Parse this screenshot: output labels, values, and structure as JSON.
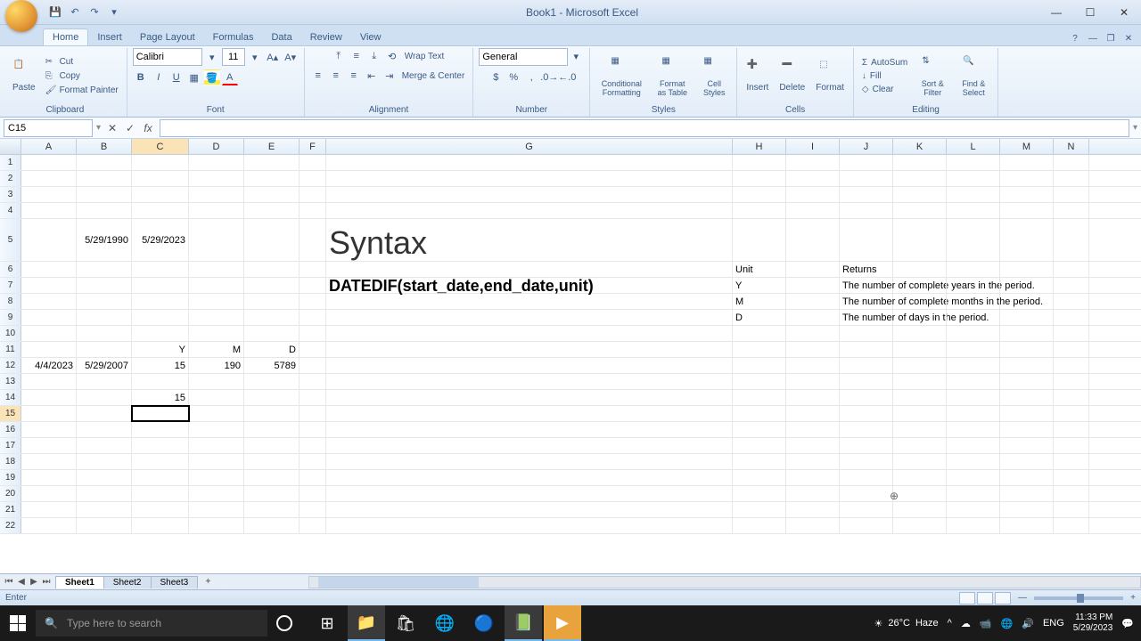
{
  "title": "Book1 - Microsoft Excel",
  "tabs": [
    "Home",
    "Insert",
    "Page Layout",
    "Formulas",
    "Data",
    "Review",
    "View"
  ],
  "ribbon": {
    "clipboard": {
      "label": "Clipboard",
      "paste": "Paste",
      "cut": "Cut",
      "copy": "Copy",
      "painter": "Format Painter"
    },
    "font": {
      "label": "Font",
      "name": "Calibri",
      "size": "11"
    },
    "alignment": {
      "label": "Alignment",
      "wrap": "Wrap Text",
      "merge": "Merge & Center"
    },
    "number": {
      "label": "Number",
      "format": "General"
    },
    "styles": {
      "label": "Styles",
      "cond": "Conditional Formatting",
      "table": "Format as Table",
      "cell": "Cell Styles"
    },
    "cells": {
      "label": "Cells",
      "insert": "Insert",
      "delete": "Delete",
      "format": "Format"
    },
    "editing": {
      "label": "Editing",
      "autosum": "AutoSum",
      "fill": "Fill",
      "clear": "Clear",
      "sort": "Sort & Filter",
      "find": "Find & Select"
    }
  },
  "name_box": "C15",
  "columns": [
    "A",
    "B",
    "C",
    "D",
    "E",
    "F",
    "G",
    "H",
    "I",
    "J",
    "K",
    "L",
    "M",
    "N"
  ],
  "row_5": {
    "B": "5/29/1990",
    "C": "5/29/2023",
    "G_syntax": "Syntax"
  },
  "row_6": {
    "H": "Unit",
    "J": "Returns"
  },
  "row_7": {
    "G_formula": "DATEDIF(start_date,end_date,unit)",
    "H": "Y",
    "J": "The number of complete years in the period."
  },
  "row_8": {
    "H": "M",
    "J": "The number of complete months in the period."
  },
  "row_9": {
    "H": "D",
    "J": "The number of days in the period."
  },
  "row_11": {
    "C": "Y",
    "D": "M",
    "E": "D"
  },
  "row_12": {
    "A": "4/4/2023",
    "B": "5/29/2007",
    "C": "15",
    "D": "190",
    "E": "5789"
  },
  "row_14": {
    "C": "15"
  },
  "sheets": [
    "Sheet1",
    "Sheet2",
    "Sheet3"
  ],
  "status": "Enter",
  "taskbar": {
    "search_placeholder": "Type here to search",
    "weather_temp": "26°C",
    "weather_cond": "Haze",
    "time": "11:33 PM",
    "date": "5/29/2023"
  }
}
